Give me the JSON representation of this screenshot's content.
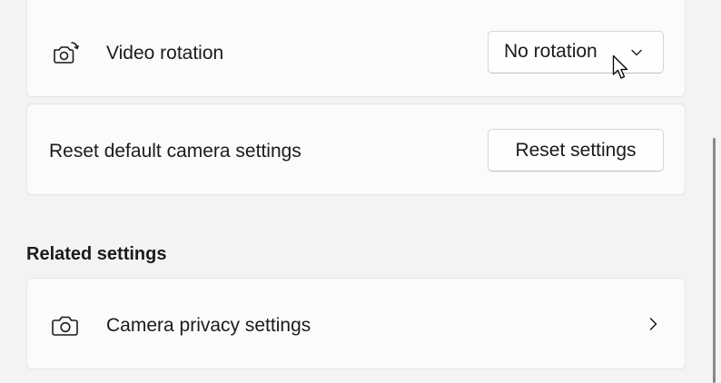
{
  "video_rotation": {
    "icon": "camera-rotate-icon",
    "label": "Video rotation",
    "selected_value": "No rotation"
  },
  "reset_camera": {
    "label": "Reset default camera settings",
    "button_label": "Reset settings"
  },
  "related_settings": {
    "heading": "Related settings",
    "camera_privacy": {
      "icon": "camera-icon",
      "label": "Camera privacy settings"
    }
  }
}
